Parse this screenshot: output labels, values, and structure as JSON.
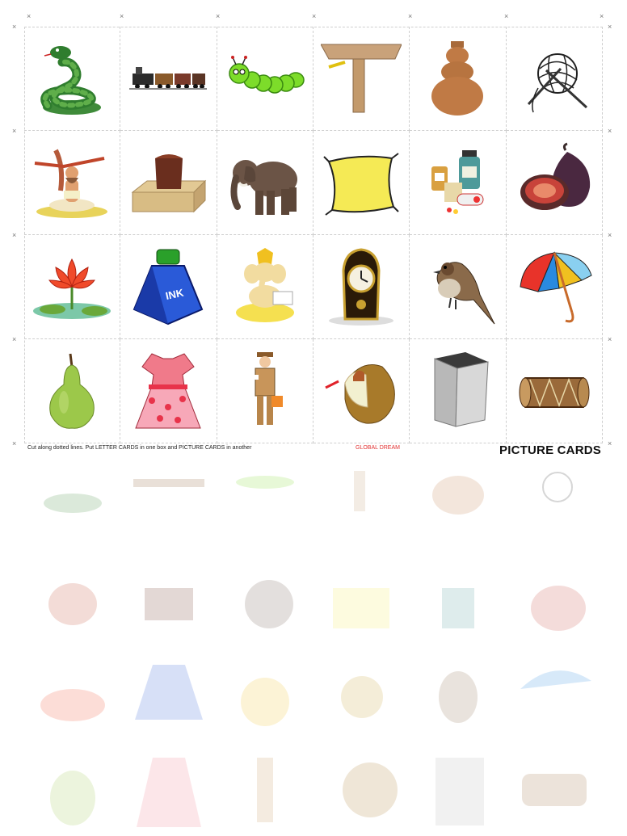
{
  "footer": {
    "instructions": "Cut along dotted lines. Put LETTER CARDS in one box and PICTURE CARDS in another",
    "brand": "GLOBAL DREAM",
    "title": "PICTURE CARDS"
  },
  "cards": [
    {
      "icon": "snake-icon"
    },
    {
      "icon": "train-icon"
    },
    {
      "icon": "caterpillar-icon"
    },
    {
      "icon": "table-corner-icon"
    },
    {
      "icon": "pot-icon"
    },
    {
      "icon": "yarn-ball-icon"
    },
    {
      "icon": "yogi-icon"
    },
    {
      "icon": "cake-box-icon"
    },
    {
      "icon": "elephant-icon"
    },
    {
      "icon": "pillow-icon"
    },
    {
      "icon": "medicine-icon"
    },
    {
      "icon": "fig-icon"
    },
    {
      "icon": "lotus-icon"
    },
    {
      "icon": "ink-bottle-icon"
    },
    {
      "icon": "ganesha-icon"
    },
    {
      "icon": "clock-icon"
    },
    {
      "icon": "sparrow-icon"
    },
    {
      "icon": "umbrella-icon"
    },
    {
      "icon": "pear-icon"
    },
    {
      "icon": "dress-icon"
    },
    {
      "icon": "postman-icon"
    },
    {
      "icon": "coconut-icon"
    },
    {
      "icon": "tin-can-icon"
    },
    {
      "icon": "drum-icon"
    }
  ],
  "ink_label": "INK"
}
